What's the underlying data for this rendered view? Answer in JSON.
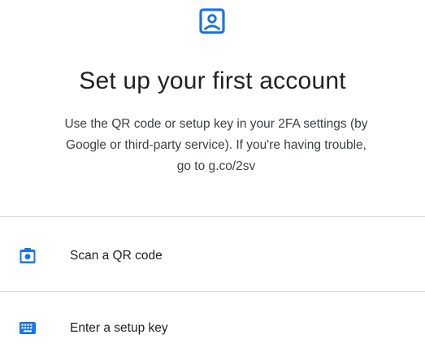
{
  "header": {
    "icon": "account-box-icon",
    "accent_color": "#1a73e8"
  },
  "title": "Set up your first account",
  "description": {
    "line1": "Use the QR code or setup key in your 2FA settings (by",
    "line2": "Google or third-party service). If you're having trouble,",
    "line3": "go to g.co/2sv"
  },
  "options": [
    {
      "icon": "qr-camera-icon",
      "label": "Scan a QR code"
    },
    {
      "icon": "keyboard-icon",
      "label": "Enter a setup key"
    }
  ]
}
